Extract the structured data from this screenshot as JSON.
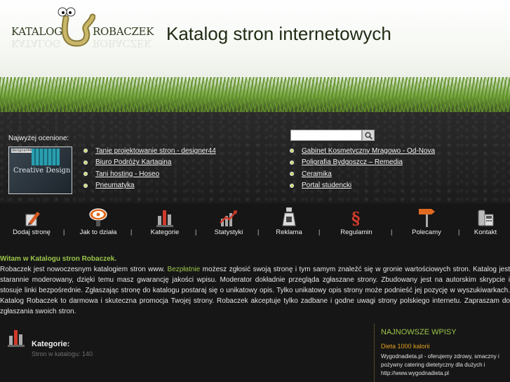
{
  "logo": {
    "left_word": "KATALOG",
    "right_word": "ROBACZEK"
  },
  "site_title": "Katalog stron internetowych",
  "search": {
    "placeholder": ""
  },
  "best": {
    "label": "Najwyżej ocenione:",
    "thumb_text": "Creative Design",
    "thumb_tag": "designer44.pl"
  },
  "links_left": [
    "Tanie projektowanie stron - designer44",
    "Biuro Podróży Kartagina",
    "Tani hosting - Hoseo",
    "Pneumatyka"
  ],
  "links_right": [
    "Gabinet Kosmetyczny Mragowo - Od-Nova",
    "Poligrafia Bydgoszcz – Remedia",
    "Ceramika",
    "Portal studencki"
  ],
  "nav": [
    {
      "label": "Dodaj stronę",
      "icon": "pencil-document-icon"
    },
    {
      "label": "Jak to działa",
      "icon": "info-bubble-icon"
    },
    {
      "label": "Kategorie",
      "icon": "bar-chart-icon"
    },
    {
      "label": "Statystyki",
      "icon": "trend-chart-icon"
    },
    {
      "label": "Reklama",
      "icon": "money-bag-icon"
    },
    {
      "label": "Regulamin",
      "icon": "paragraph-icon"
    },
    {
      "label": "Polecamy",
      "icon": "signpost-icon"
    },
    {
      "label": "Kontakt",
      "icon": "phone-icon"
    }
  ],
  "nav_separator": "|",
  "welcome": {
    "title": "Witam w Katalogu stron Robaczek.",
    "text_before": "Robaczek jest nowoczesnym katalogiem stron www. ",
    "link": "Bezpłatnie",
    "text_after": " możesz zgłosić swoją stronę i tym samym znaleźć się w gronie wartościowych stron. Katalog jest starannie moderowany, dzięki temu masz gwarancję jakości wpisu. Moderator dokładnie przegląda zgłaszane strony. Zbudowany jest na autorskim skrypcie i stosuje linki bezpośrednie. Zgłaszając stronę do katalogu postaraj się o unikatowy opis. Tylko unikatowy opis strony może podnieść jej pozycję w wyszukiwarkach. Katalog Robaczek to darmowa i skuteczna promocja Twojej strony. Robaczek akceptuje tylko zadbane i godne uwagi strony polskiego internetu. Zapraszam do zgłaszania swoich stron."
  },
  "categories": {
    "title": "Kategorie:",
    "count": "Stron w katalogu: 140"
  },
  "recent": {
    "heading": "NAJNOWSZE WPISY",
    "entry_title": "Dieta 1000 kalorii",
    "entry_desc": "Wygodnadieta.pl - oferujemy zdrowy, smaczny i pożywny catering dietetyczny dla dużych i http://www.wygodnadieta.pl"
  }
}
